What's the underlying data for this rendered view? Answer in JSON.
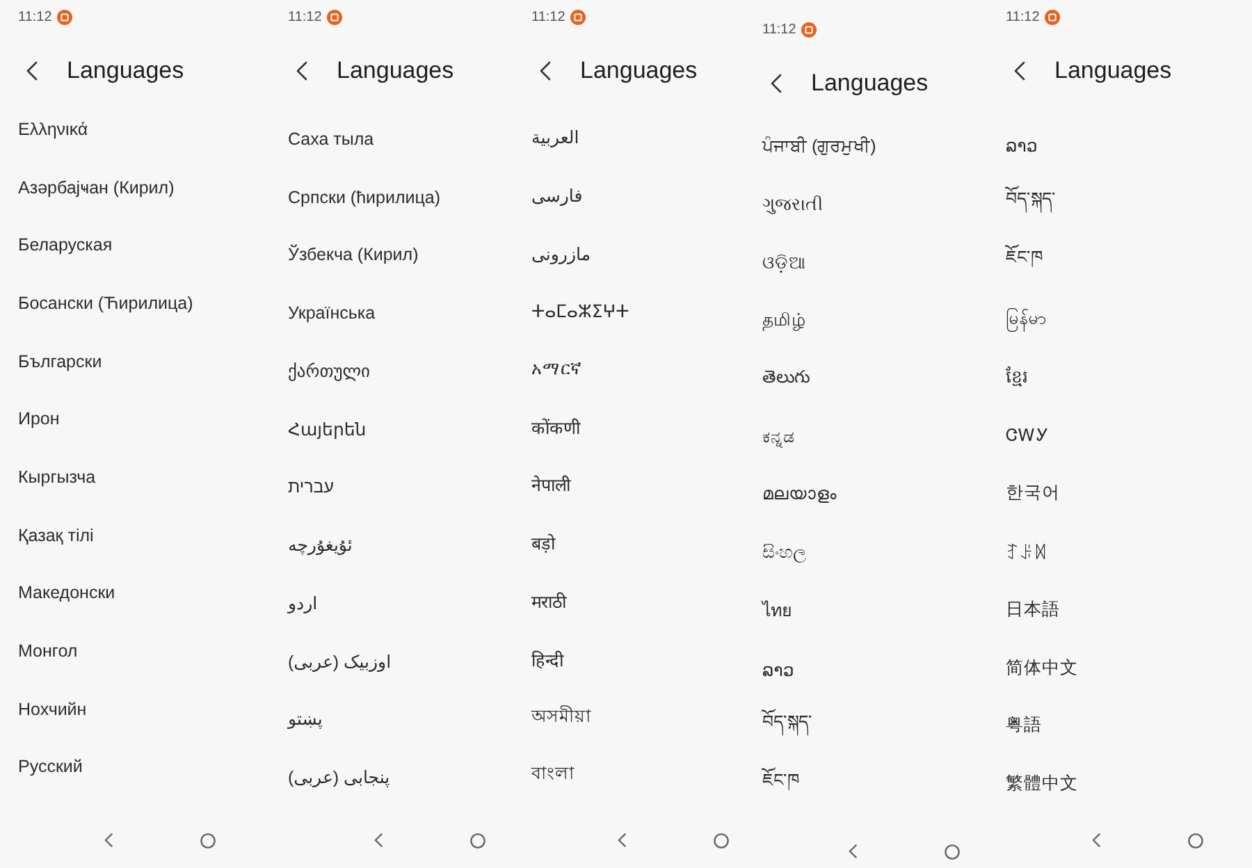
{
  "screens": [
    {
      "status_bar": {
        "time": "11:12"
      },
      "header": {
        "title": "Languages"
      },
      "languages": [
        "Ελληνικά",
        "Азәрбајҹан (Кирил)",
        "Беларуская",
        "Босански (Ћирилица)",
        "Български",
        "Ирон",
        "Кыргызча",
        "Қазақ тілі",
        "Македонски",
        "Монгол",
        "Нохчийн",
        "Русский"
      ]
    },
    {
      "status_bar": {
        "time": "11:12"
      },
      "header": {
        "title": "Languages"
      },
      "languages": [
        "Саха тыла",
        "Српски (ћирилица)",
        "Ўзбекча (Кирил)",
        "Українська",
        "ქართული",
        "Հայերեն",
        "עברית",
        "ئۇيغۇرچە",
        "اردو",
        "اوزبیک (عربی)",
        "پښتو",
        "پنجابی (عربی)"
      ]
    },
    {
      "status_bar": {
        "time": "11:12"
      },
      "header": {
        "title": "Languages"
      },
      "languages": [
        "العربية",
        "فارسی",
        "مازرونی",
        "ⵜⴰⵎⴰⵣⵉⵖⵜ",
        "አማርኛ",
        "कोंकणी",
        "नेपाली",
        "बड़ो",
        "मराठी",
        "हिन्दी",
        "অসমীয়া",
        "বাংলা"
      ]
    },
    {
      "status_bar": {
        "time": "11:12"
      },
      "header": {
        "title": "Languages"
      },
      "languages": [
        "ਪੰਜਾਬੀ (ਗੁਰਮੁਖੀ)",
        "ગુજરાતી",
        "ଓଡ଼ିଆ",
        "தமிழ்",
        "తెలుగు",
        "ಕನ್ನಡ",
        "മലയാളം",
        "සිංහල",
        "ไทย",
        "ລາວ",
        "བོད་སྐད་",
        "ཇོང་ཁ"
      ]
    },
    {
      "status_bar": {
        "time": "11:12"
      },
      "header": {
        "title": "Languages"
      },
      "languages": [
        "ລາວ",
        "བོད་སྐད་",
        "ཇོང་ཁ",
        "မြန်မာ",
        "ខ្មែរ",
        "ᏣᎳᎩ",
        "한국어",
        "ꆈꌠꉙ",
        "日本語",
        "简体中文",
        "粤語",
        "繁體中文"
      ]
    }
  ]
}
